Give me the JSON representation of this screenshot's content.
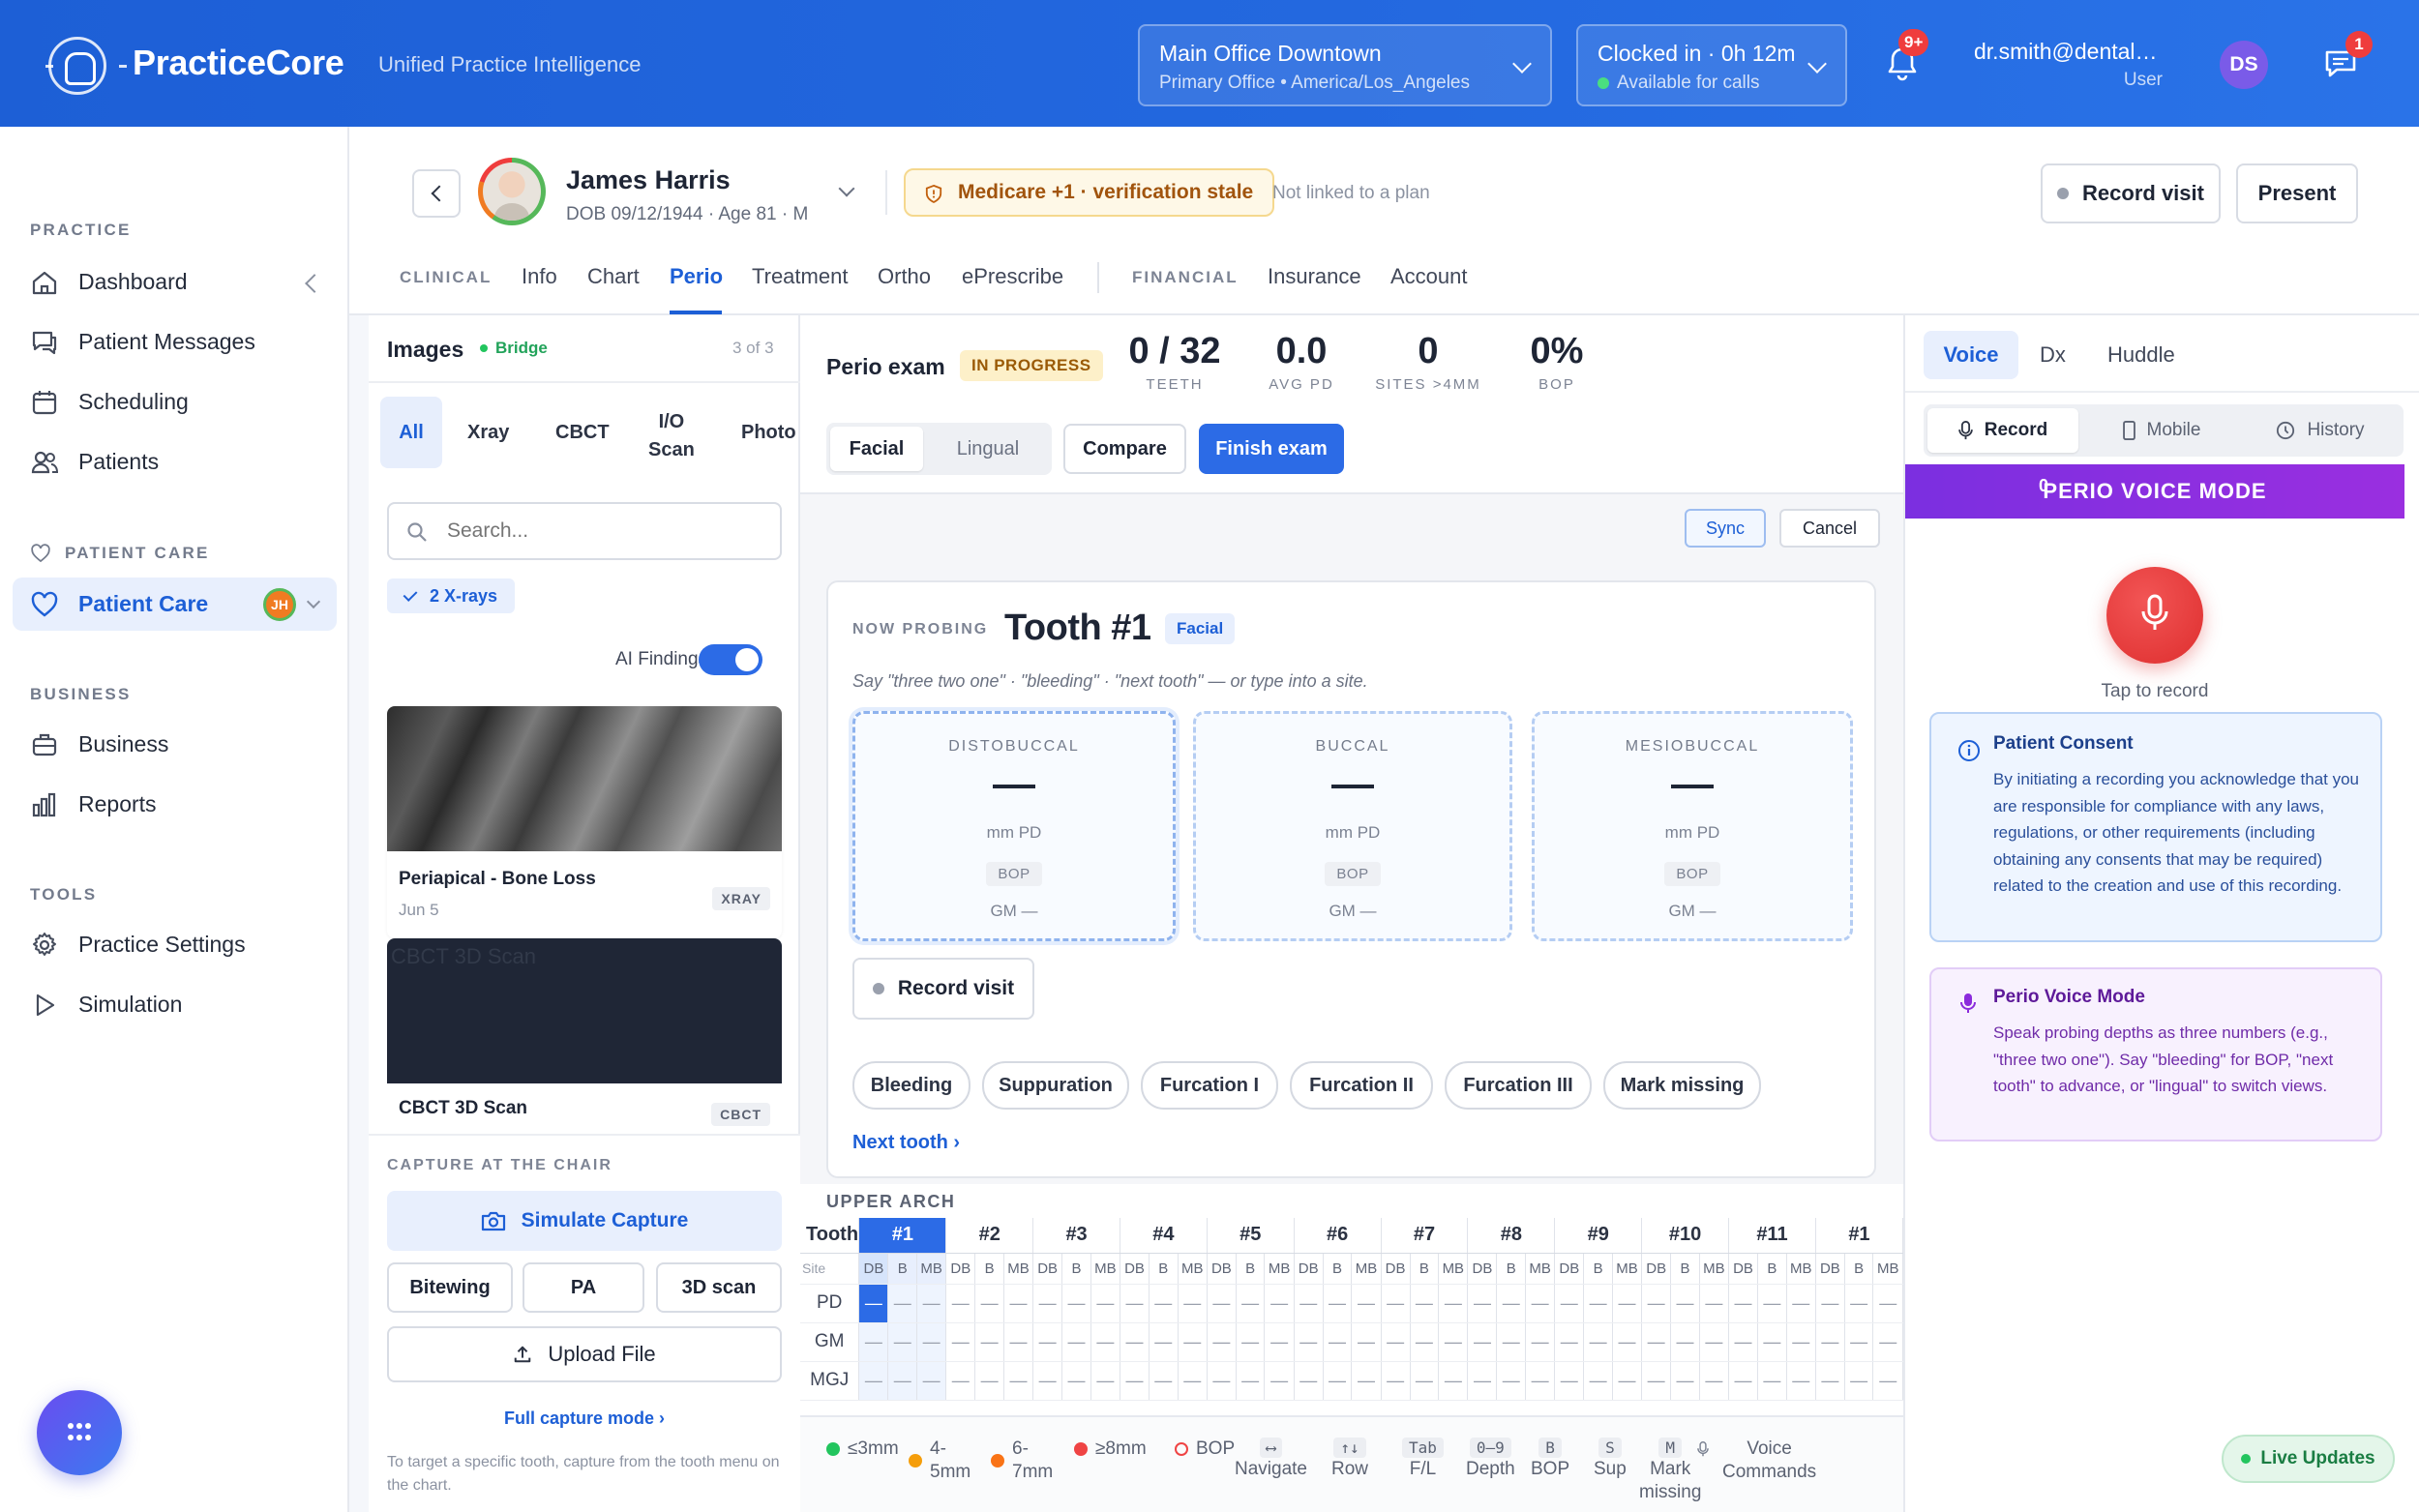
{
  "app": {
    "name": "PracticeCore",
    "tagline": "Unified Practice Intelligence"
  },
  "header": {
    "location": {
      "name": "Main Office Downtown",
      "sub": "Primary Office • America/Los_Angeles"
    },
    "clock": {
      "status": "Clocked in · 0h 12m",
      "sub": "Available for calls",
      "status_color": "#4ade80"
    },
    "notifications_badge": "9+",
    "messages_badge": "1",
    "user": {
      "email": "dr.smith@dentalpractice.com",
      "role": "User",
      "initials": "DS"
    }
  },
  "sidebar": {
    "sections": [
      {
        "label": "PRACTICE"
      },
      {
        "label": "PATIENT CARE"
      },
      {
        "label": "BUSINESS"
      },
      {
        "label": "TOOLS"
      }
    ],
    "items": [
      {
        "label": "Dashboard",
        "icon": "home-icon"
      },
      {
        "label": "Patient Messages",
        "icon": "messages-icon"
      },
      {
        "label": "Scheduling",
        "icon": "calendar-icon"
      },
      {
        "label": "Patients",
        "icon": "users-icon"
      },
      {
        "label": "Patient Care",
        "icon": "heart-icon",
        "active": true,
        "badge": "JH"
      },
      {
        "label": "Business",
        "icon": "briefcase-icon"
      },
      {
        "label": "Reports",
        "icon": "bar-chart-icon"
      },
      {
        "label": "Practice Settings",
        "icon": "gear-icon"
      },
      {
        "label": "Simulation",
        "icon": "play-icon"
      }
    ]
  },
  "patient": {
    "name": "James Harris",
    "details": "DOB 09/12/1944 · Age 81 · M",
    "insurance_alert": "Medicare +1 · verification stale",
    "plan_status": "Not linked to a plan",
    "record_visit": "Record visit",
    "present": "Present"
  },
  "tabs": {
    "clinical_label": "CLINICAL",
    "financial_label": "FINANCIAL",
    "clinical": [
      "Info",
      "Chart",
      "Perio",
      "Treatment",
      "Ortho",
      "ePrescribe"
    ],
    "financial": [
      "Insurance",
      "Account"
    ],
    "active": "Perio"
  },
  "images": {
    "title": "Images",
    "status": "Bridge",
    "count": "3 of 3",
    "filters": [
      "All",
      "Xray",
      "CBCT",
      "I/O\nScan",
      "Photo"
    ],
    "search_placeholder": "Search...",
    "chip": "2 X-rays",
    "ai_findings": "AI Findings",
    "cards": [
      {
        "title": "Periapical - Bone Loss",
        "date": "Jun 5",
        "tag": "XRAY"
      },
      {
        "title": "CBCT 3D Scan",
        "alt": "CBCT 3D Scan",
        "tag": "CBCT"
      }
    ],
    "capture_header": "CAPTURE AT THE CHAIR",
    "simulate": "Simulate Capture",
    "capture_types": [
      "Bitewing",
      "PA",
      "3D scan"
    ],
    "upload": "Upload File",
    "full_capture": "Full capture mode ›",
    "hint": "To target a specific tooth, capture from the tooth menu on the chart."
  },
  "perio": {
    "title": "Perio exam",
    "status": "IN PROGRESS",
    "stats": [
      {
        "value": "0 / 32",
        "label": "TEETH"
      },
      {
        "value": "0.0",
        "label": "AVG PD"
      },
      {
        "value": "0",
        "label": "SITES >4MM"
      },
      {
        "value": "0%",
        "label": "BOP"
      }
    ],
    "surface_toggle": [
      "Facial",
      "Lingual"
    ],
    "compare": "Compare",
    "finish": "Finish exam",
    "sync": "Sync",
    "cancel": "Cancel",
    "now_probing": "NOW PROBING",
    "tooth": "Tooth #1",
    "surface": "Facial",
    "instructions": "Say \"three two one\" · \"bleeding\" · \"next tooth\" — or type into a site.",
    "sites": [
      {
        "label": "DISTOBUCCAL",
        "value": "—",
        "unit": "mm PD",
        "bop": "BOP",
        "gm": "GM —"
      },
      {
        "label": "BUCCAL",
        "value": "—",
        "unit": "mm PD",
        "bop": "BOP",
        "gm": "GM —"
      },
      {
        "label": "MESIOBUCCAL",
        "value": "—",
        "unit": "mm PD",
        "bop": "BOP",
        "gm": "GM —"
      }
    ],
    "record_visit": "Record visit",
    "findings": [
      "Bleeding",
      "Suppuration",
      "Furcation I",
      "Furcation II",
      "Furcation III",
      "Mark missing"
    ],
    "next_tooth": "Next tooth ›",
    "arch_label": "UPPER ARCH",
    "grid": {
      "tooth_label": "Tooth",
      "site_label": "Site",
      "teeth": [
        "#1",
        "#2",
        "#3",
        "#4",
        "#5",
        "#6",
        "#7",
        "#8",
        "#9",
        "#10",
        "#11",
        "#1"
      ],
      "sites": [
        "DB",
        "B",
        "MB"
      ],
      "rows": [
        "PD",
        "GM",
        "MGJ"
      ],
      "empty": "—"
    },
    "legend": [
      {
        "label": "≤3mm",
        "color": "#22c55e",
        "type": "dot"
      },
      {
        "label": "4-\n5mm",
        "color": "#f59e0b",
        "type": "dot"
      },
      {
        "label": "6-\n7mm",
        "color": "#f97316",
        "type": "dot"
      },
      {
        "label": "≥8mm",
        "color": "#ef4444",
        "type": "dot"
      },
      {
        "label": "BOP",
        "color": "#ef4444",
        "type": "ring"
      }
    ],
    "shortcuts": [
      {
        "key": "⟷",
        "label": "Navigate"
      },
      {
        "key": "↑↓",
        "label": "Row"
      },
      {
        "key": "Tab",
        "label": "F/L"
      },
      {
        "key": "0–9",
        "label": "Depth"
      },
      {
        "key": "B",
        "label": "BOP"
      },
      {
        "key": "S",
        "label": "Sup"
      },
      {
        "key": "M",
        "label": "Mark\nmissing"
      },
      {
        "key": "",
        "label": "Voice\nCommands"
      }
    ]
  },
  "voice": {
    "tabs": [
      "Voice",
      "Dx",
      "Huddle"
    ],
    "modes": [
      "Record",
      "Mobile",
      "History"
    ],
    "banner_count": "0",
    "banner": "PERIO VOICE MODE",
    "tap": "Tap to record",
    "consent_title": "Patient Consent",
    "consent_text": "By initiating a recording you acknowledge that you are responsible for compliance with any laws, regulations, or other requirements (including obtaining any consents that may be required) related to the creation and use of this recording.",
    "mode_title": "Perio Voice Mode",
    "mode_text": "Speak probing depths as three numbers (e.g., \"three two one\"). Say \"bleeding\" for BOP, \"next tooth\" to advance, or \"lingual\" to switch views.",
    "live": "Live Updates"
  },
  "colors": {
    "primary": "#1d5fd6",
    "voice_banner": "#8b2bdc",
    "record": "#ef3d3d",
    "live": "#22a35a"
  }
}
